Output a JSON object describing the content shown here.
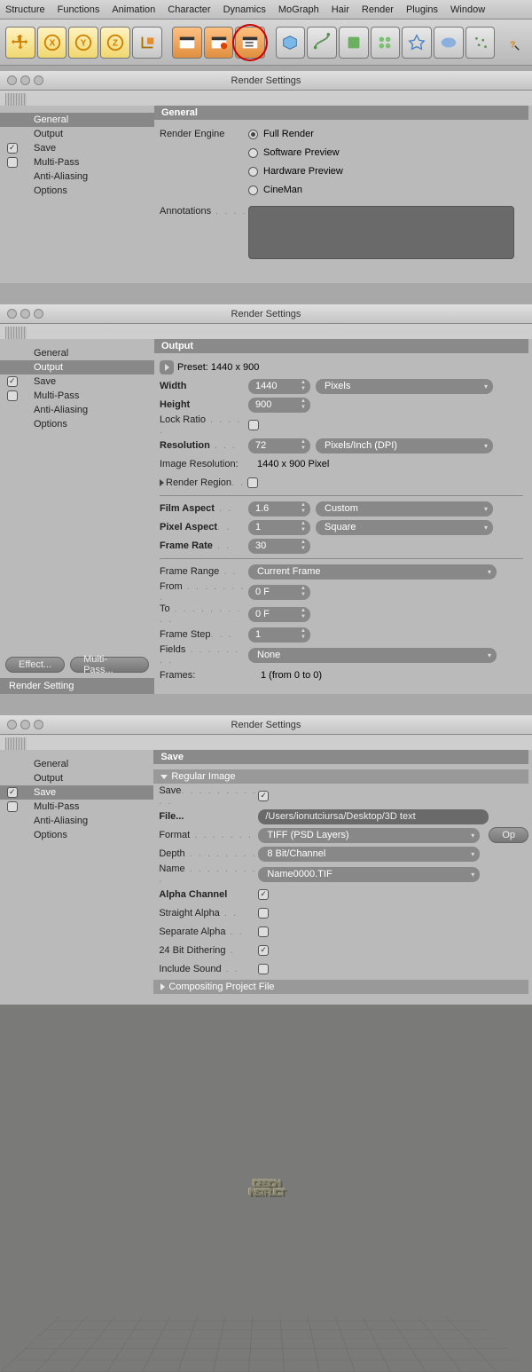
{
  "menubar": [
    "Structure",
    "Functions",
    "Animation",
    "Character",
    "Dynamics",
    "MoGraph",
    "Hair",
    "Render",
    "Plugins",
    "Window"
  ],
  "windowTitle": "Render Settings",
  "sidebar": {
    "items": [
      "General",
      "Output",
      "Save",
      "Multi-Pass",
      "Anti-Aliasing",
      "Options"
    ]
  },
  "panel1": {
    "head": "General",
    "renderEngineLabel": "Render Engine",
    "options": [
      "Full Render",
      "Software Preview",
      "Hardware Preview",
      "CineMan"
    ],
    "annotationsLabel": "Annotations"
  },
  "panel2": {
    "head": "Output",
    "presetLabel": "Preset:",
    "presetValue": "1440 x 900",
    "widthLabel": "Width",
    "widthValue": "1440",
    "widthUnit": "Pixels",
    "heightLabel": "Height",
    "heightValue": "900",
    "lockRatioLabel": "Lock Ratio",
    "resolutionLabel": "Resolution",
    "resolutionValue": "72",
    "resolutionUnit": "Pixels/Inch (DPI)",
    "imageResLabel": "Image Resolution:",
    "imageResValue": "1440 x 900 Pixel",
    "renderRegionLabel": "Render Region",
    "filmAspectLabel": "Film Aspect",
    "filmAspectValue": "1.6",
    "filmAspectUnit": "Custom",
    "pixelAspectLabel": "Pixel Aspect",
    "pixelAspectValue": "1",
    "pixelAspectUnit": "Square",
    "frameRateLabel": "Frame Rate",
    "frameRateValue": "30",
    "frameRangeLabel": "Frame Range",
    "frameRangeValue": "Current Frame",
    "fromLabel": "From",
    "fromValue": "0 F",
    "toLabel": "To",
    "toValue": "0 F",
    "frameStepLabel": "Frame Step",
    "frameStepValue": "1",
    "fieldsLabel": "Fields",
    "fieldsValue": "None",
    "framesLabel": "Frames:",
    "framesValue": "1 (from 0 to 0)",
    "effectBtn": "Effect...",
    "multipassBtn": "Multi-Pass...",
    "statusText": "Render Setting"
  },
  "panel3": {
    "head": "Save",
    "regularImage": "Regular Image",
    "saveLabel": "Save",
    "fileLabel": "File...",
    "fileValue": "/Users/ionutciursa/Desktop/3D text",
    "formatLabel": "Format",
    "formatValue": "TIFF (PSD Layers)",
    "optBtn": "Op",
    "depthLabel": "Depth",
    "depthValue": "8 Bit/Channel",
    "nameLabel": "Name",
    "nameValue": "Name0000.TIF",
    "alphaLabel": "Alpha Channel",
    "straightLabel": "Straight Alpha",
    "separateLabel": "Separate Alpha",
    "ditherLabel": "24 Bit Dithering",
    "soundLabel": "Include Sound",
    "compositingLabel": "Compositing Project File"
  },
  "viewport": {
    "line1": "DESIGN",
    "line2": "INSTRUCT"
  }
}
